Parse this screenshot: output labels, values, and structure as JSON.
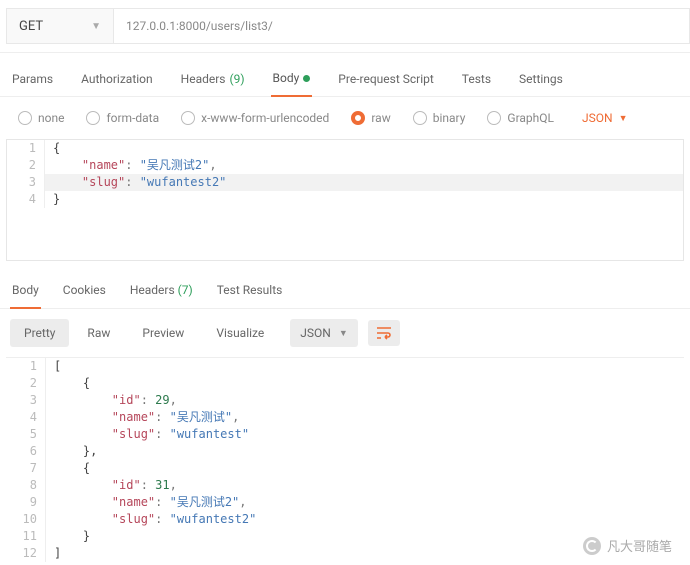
{
  "request": {
    "method": "GET",
    "url": "127.0.0.1:8000/users/list3/"
  },
  "reqTabs": {
    "params": "Params",
    "authorization": "Authorization",
    "headers": "Headers",
    "headersCount": "(9)",
    "body": "Body",
    "prerequest": "Pre-request Script",
    "tests": "Tests",
    "settings": "Settings"
  },
  "bodyRadio": {
    "none": "none",
    "formdata": "form-data",
    "urlencoded": "x-www-form-urlencoded",
    "raw": "raw",
    "binary": "binary",
    "graphql": "GraphQL",
    "rawType": "JSON"
  },
  "reqBody": {
    "l1": "{",
    "l2a": "    \"name\"",
    "l2b": ": ",
    "l2c": "\"吴凡测试2\"",
    "l2d": ",",
    "l3a": "    \"slug\"",
    "l3b": ": ",
    "l3c": "\"wufantest2\"",
    "l4": "}"
  },
  "respTabs": {
    "body": "Body",
    "cookies": "Cookies",
    "headers": "Headers",
    "headersCount": "(7)",
    "testResults": "Test Results"
  },
  "viewBar": {
    "pretty": "Pretty",
    "raw": "Raw",
    "preview": "Preview",
    "visualize": "Visualize",
    "type": "JSON"
  },
  "respBody": {
    "l1": "[",
    "l2": "    {",
    "l3a": "        \"id\"",
    "l3b": ": ",
    "l3c": "29",
    "l3d": ",",
    "l4a": "        \"name\"",
    "l4b": ": ",
    "l4c": "\"吴凡测试\"",
    "l4d": ",",
    "l5a": "        \"slug\"",
    "l5b": ": ",
    "l5c": "\"wufantest\"",
    "l6": "    },",
    "l7": "    {",
    "l8a": "        \"id\"",
    "l8b": ": ",
    "l8c": "31",
    "l8d": ",",
    "l9a": "        \"name\"",
    "l9b": ": ",
    "l9c": "\"吴凡测试2\"",
    "l9d": ",",
    "l10a": "        \"slug\"",
    "l10b": ": ",
    "l10c": "\"wufantest2\"",
    "l11": "    }",
    "l12": "]"
  },
  "gutter": {
    "1": "1",
    "2": "2",
    "3": "3",
    "4": "4",
    "5": "5",
    "6": "6",
    "7": "7",
    "8": "8",
    "9": "9",
    "10": "10",
    "11": "11",
    "12": "12"
  },
  "watermark": "凡大哥随笔"
}
